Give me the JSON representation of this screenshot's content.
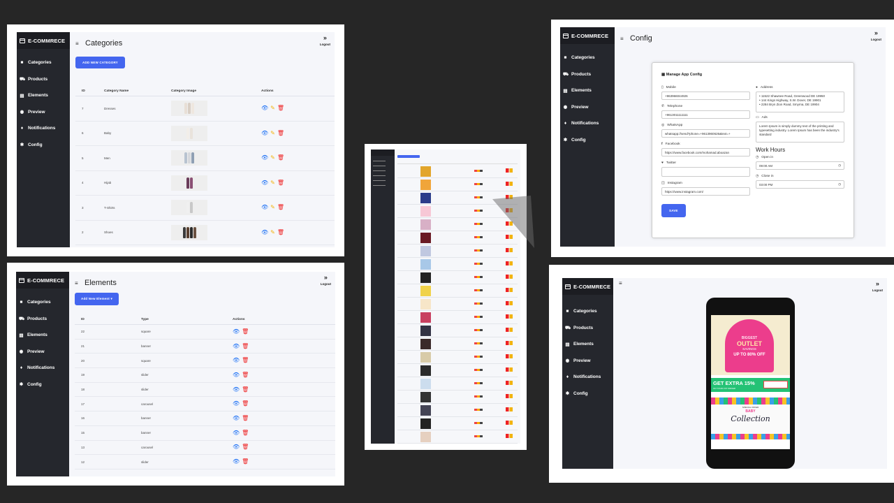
{
  "app": {
    "brand": "E-COMMRECE",
    "logout": "Logout",
    "nav": [
      {
        "label": "Categories",
        "icon": "bag-icon"
      },
      {
        "label": "Products",
        "icon": "cart-icon"
      },
      {
        "label": "Elements",
        "icon": "cards-icon"
      },
      {
        "label": "Preview",
        "icon": "eye-icon"
      },
      {
        "label": "Notifications",
        "icon": "bell-icon"
      },
      {
        "label": "Config",
        "icon": "gear-icon"
      }
    ]
  },
  "categories": {
    "title": "Categories",
    "add_button": "ADD NEW CATEGORY",
    "columns": [
      "ID",
      "Category Name",
      "Category Image",
      "Actions"
    ],
    "rows": [
      {
        "id": "7",
        "name": "Dresses"
      },
      {
        "id": "6",
        "name": "Baby"
      },
      {
        "id": "5",
        "name": "Men"
      },
      {
        "id": "4",
        "name": "Hijab"
      },
      {
        "id": "3",
        "name": "T-Shirts"
      },
      {
        "id": "2",
        "name": "Shoes"
      }
    ]
  },
  "elements": {
    "title": "Elements",
    "add_button": "Add New Element",
    "columns": [
      "ID",
      "Type",
      "Actions"
    ],
    "rows": [
      {
        "id": "22",
        "type": "square"
      },
      {
        "id": "21",
        "type": "banner"
      },
      {
        "id": "20",
        "type": "square"
      },
      {
        "id": "19",
        "type": "slider"
      },
      {
        "id": "18",
        "type": "slider"
      },
      {
        "id": "17",
        "type": "carousel"
      },
      {
        "id": "16",
        "type": "banner"
      },
      {
        "id": "15",
        "type": "banner"
      },
      {
        "id": "13",
        "type": "carousel"
      },
      {
        "id": "12",
        "type": "slider"
      }
    ]
  },
  "config": {
    "title": "Config",
    "card_title": "Manage App Config",
    "mobile_label": "Mobile",
    "mobile_value": "+963966044926",
    "telephone_label": "Telephone",
    "telephone_value": "+9613011111111",
    "whatsapp_label": "WhatsApp",
    "whatsapp_value": "whatsapp://send?phone=+9613960626&text=+",
    "facebook_label": "Facebook",
    "facebook_value": "https://www.facebook.com/mohamad.aboazan",
    "twitter_label": "Twitter",
    "twitter_value": "",
    "instagram_label": "Instagram",
    "instagram_value": "https://www.instagram.com/",
    "address_label": "Address",
    "address_lines": [
      "• 11522 Shawnee Road, Greenwood DE 19950",
      "• 144 Kings Highway, S.W. Dover, DE 19901",
      "• 2284 Bryn Zion Road, Smyrna, DE 19904"
    ],
    "ads_label": "Ads",
    "ads_value": "Lorem Ipsum is simply dummy text of the printing and typesetting industry. Lorem Ipsum has been the industry's standard",
    "work_hours_title": "Work Hours",
    "open_label": "Open in",
    "open_value": "09:00 AM",
    "close_label": "Close in",
    "close_value": "03:00 PM",
    "save_button": "SAVE"
  },
  "preview": {
    "banner1_line1": "BIGGEST",
    "banner1_line2": "OUTLET",
    "banner1_line3": "SAVINGS",
    "banner1_line4": "UP TO 80% OFF",
    "banner2_main": "GET EXTRA 15%",
    "banner2_sub": "ON YOUR 1ST ORDER",
    "banner3_small": "SPECIAL OFFER",
    "banner3_baby": "BABY",
    "banner3_collection": "Collection"
  },
  "products_rows": 21,
  "colors": {
    "sidebar": "#25272d",
    "brand_bar": "#1c1d22",
    "accent": "#4466ef",
    "view": "#1c70f5",
    "edit": "#f2b30e",
    "delete": "#e22222",
    "pink": "#ec3d8c",
    "green": "#24c275"
  }
}
